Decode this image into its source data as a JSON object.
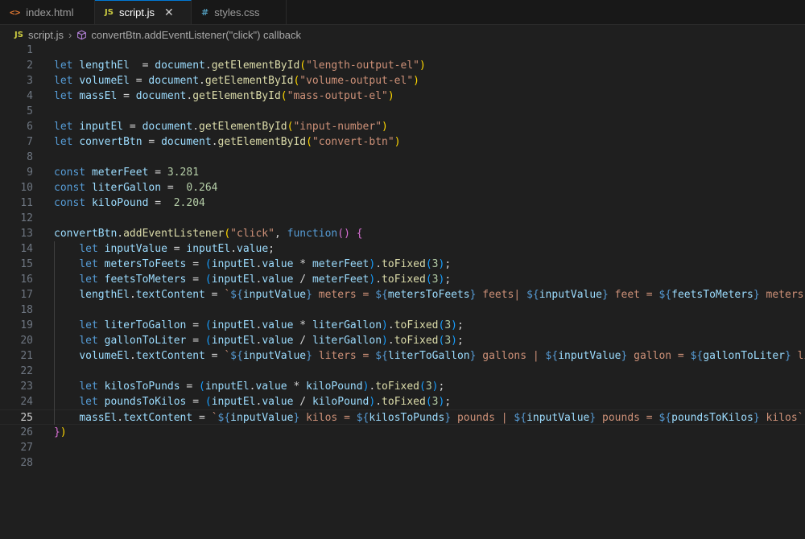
{
  "tabs": [
    {
      "icon": "<>",
      "label": "index.html"
    },
    {
      "icon": "JS",
      "label": "script.js"
    },
    {
      "icon": "#",
      "label": "styles.css"
    }
  ],
  "close_glyph": "✕",
  "breadcrumb": {
    "file_icon": "JS",
    "file": "script.js",
    "separator": "›",
    "symbol": "convertBtn.addEventListener(\"click\") callback"
  },
  "editor": {
    "active_line": 25,
    "lines": [
      {
        "n": "1",
        "t": []
      },
      {
        "n": "2",
        "t": [
          [
            "kw",
            "let "
          ],
          [
            "vr",
            "lengthEl"
          ],
          [
            "",
            "  = "
          ],
          [
            "vr",
            "document"
          ],
          [
            "",
            "."
          ],
          [
            "fn",
            "getElementById"
          ],
          [
            "p1",
            "("
          ],
          [
            "st",
            "\"length-output-el\""
          ],
          [
            "p1",
            ")"
          ]
        ]
      },
      {
        "n": "3",
        "t": [
          [
            "kw",
            "let "
          ],
          [
            "vr",
            "volumeEl"
          ],
          [
            "",
            " = "
          ],
          [
            "vr",
            "document"
          ],
          [
            "",
            "."
          ],
          [
            "fn",
            "getElementById"
          ],
          [
            "p1",
            "("
          ],
          [
            "st",
            "\"volume-output-el\""
          ],
          [
            "p1",
            ")"
          ]
        ]
      },
      {
        "n": "4",
        "t": [
          [
            "kw",
            "let "
          ],
          [
            "vr",
            "massEl"
          ],
          [
            "",
            " = "
          ],
          [
            "vr",
            "document"
          ],
          [
            "",
            "."
          ],
          [
            "fn",
            "getElementById"
          ],
          [
            "p1",
            "("
          ],
          [
            "st",
            "\"mass-output-el\""
          ],
          [
            "p1",
            ")"
          ]
        ]
      },
      {
        "n": "5",
        "t": []
      },
      {
        "n": "6",
        "t": [
          [
            "kw",
            "let "
          ],
          [
            "vr",
            "inputEl"
          ],
          [
            "",
            " = "
          ],
          [
            "vr",
            "document"
          ],
          [
            "",
            "."
          ],
          [
            "fn",
            "getElementById"
          ],
          [
            "p1",
            "("
          ],
          [
            "st",
            "\"input-number\""
          ],
          [
            "p1",
            ")"
          ]
        ]
      },
      {
        "n": "7",
        "t": [
          [
            "kw",
            "let "
          ],
          [
            "vr",
            "convertBtn"
          ],
          [
            "",
            " = "
          ],
          [
            "vr",
            "document"
          ],
          [
            "",
            "."
          ],
          [
            "fn",
            "getElementById"
          ],
          [
            "p1",
            "("
          ],
          [
            "st",
            "\"convert-btn\""
          ],
          [
            "p1",
            ")"
          ]
        ]
      },
      {
        "n": "8",
        "t": []
      },
      {
        "n": "9",
        "t": [
          [
            "kw",
            "const "
          ],
          [
            "vr",
            "meterFeet"
          ],
          [
            "",
            " = "
          ],
          [
            "nu",
            "3.281"
          ]
        ]
      },
      {
        "n": "10",
        "t": [
          [
            "kw",
            "const "
          ],
          [
            "vr",
            "literGallon"
          ],
          [
            "",
            " =  "
          ],
          [
            "nu",
            "0.264"
          ]
        ]
      },
      {
        "n": "11",
        "t": [
          [
            "kw",
            "const "
          ],
          [
            "vr",
            "kiloPound"
          ],
          [
            "",
            " =  "
          ],
          [
            "nu",
            "2.204"
          ]
        ]
      },
      {
        "n": "12",
        "t": []
      },
      {
        "n": "13",
        "t": [
          [
            "vr",
            "convertBtn"
          ],
          [
            "",
            "."
          ],
          [
            "fn",
            "addEventListener"
          ],
          [
            "p1",
            "("
          ],
          [
            "st",
            "\"click\""
          ],
          [
            "",
            ", "
          ],
          [
            "kw",
            "function"
          ],
          [
            "p2",
            "()"
          ],
          [
            "",
            " "
          ],
          [
            "p2",
            "{"
          ]
        ]
      },
      {
        "n": "14",
        "t": [
          [
            "",
            "    "
          ],
          [
            "kw",
            "let "
          ],
          [
            "vr",
            "inputValue"
          ],
          [
            "",
            " = "
          ],
          [
            "vr",
            "inputEl"
          ],
          [
            "",
            "."
          ],
          [
            "vr",
            "value"
          ],
          [
            "",
            ";"
          ]
        ]
      },
      {
        "n": "15",
        "t": [
          [
            "",
            "    "
          ],
          [
            "kw",
            "let "
          ],
          [
            "vr",
            "metersToFeets"
          ],
          [
            "",
            " = "
          ],
          [
            "p3",
            "("
          ],
          [
            "vr",
            "inputEl"
          ],
          [
            "",
            "."
          ],
          [
            "vr",
            "value"
          ],
          [
            "",
            " * "
          ],
          [
            "vr",
            "meterFeet"
          ],
          [
            "p3",
            ")"
          ],
          [
            "",
            "."
          ],
          [
            "fn",
            "toFixed"
          ],
          [
            "p3",
            "("
          ],
          [
            "nu",
            "3"
          ],
          [
            "p3",
            ")"
          ],
          [
            "",
            ";"
          ]
        ]
      },
      {
        "n": "16",
        "t": [
          [
            "",
            "    "
          ],
          [
            "kw",
            "let "
          ],
          [
            "vr",
            "feetsToMeters"
          ],
          [
            "",
            " = "
          ],
          [
            "p3",
            "("
          ],
          [
            "vr",
            "inputEl"
          ],
          [
            "",
            "."
          ],
          [
            "vr",
            "value"
          ],
          [
            "",
            " / "
          ],
          [
            "vr",
            "meterFeet"
          ],
          [
            "p3",
            ")"
          ],
          [
            "",
            "."
          ],
          [
            "fn",
            "toFixed"
          ],
          [
            "p3",
            "("
          ],
          [
            "nu",
            "3"
          ],
          [
            "p3",
            ")"
          ],
          [
            "",
            ";"
          ]
        ]
      },
      {
        "n": "17",
        "t": [
          [
            "",
            "    "
          ],
          [
            "vr",
            "lengthEl"
          ],
          [
            "",
            "."
          ],
          [
            "vr",
            "textContent"
          ],
          [
            "",
            " = "
          ],
          [
            "st",
            "`"
          ],
          [
            "tp",
            "${"
          ],
          [
            "vr",
            "inputValue"
          ],
          [
            "tp",
            "}"
          ],
          [
            "st",
            " meters = "
          ],
          [
            "tp",
            "${"
          ],
          [
            "vr",
            "metersToFeets"
          ],
          [
            "tp",
            "}"
          ],
          [
            "st",
            " feets| "
          ],
          [
            "tp",
            "${"
          ],
          [
            "vr",
            "inputValue"
          ],
          [
            "tp",
            "}"
          ],
          [
            "st",
            " feet = "
          ],
          [
            "tp",
            "${"
          ],
          [
            "vr",
            "feetsToMeters"
          ],
          [
            "tp",
            "}"
          ],
          [
            "st",
            " meters`"
          ],
          [
            "",
            ";"
          ]
        ]
      },
      {
        "n": "18",
        "t": []
      },
      {
        "n": "19",
        "t": [
          [
            "",
            "    "
          ],
          [
            "kw",
            "let "
          ],
          [
            "vr",
            "literToGallon"
          ],
          [
            "",
            " = "
          ],
          [
            "p3",
            "("
          ],
          [
            "vr",
            "inputEl"
          ],
          [
            "",
            "."
          ],
          [
            "vr",
            "value"
          ],
          [
            "",
            " * "
          ],
          [
            "vr",
            "literGallon"
          ],
          [
            "p3",
            ")"
          ],
          [
            "",
            "."
          ],
          [
            "fn",
            "toFixed"
          ],
          [
            "p3",
            "("
          ],
          [
            "nu",
            "3"
          ],
          [
            "p3",
            ")"
          ],
          [
            "",
            ";"
          ]
        ]
      },
      {
        "n": "20",
        "t": [
          [
            "",
            "    "
          ],
          [
            "kw",
            "let "
          ],
          [
            "vr",
            "gallonToLiter"
          ],
          [
            "",
            " = "
          ],
          [
            "p3",
            "("
          ],
          [
            "vr",
            "inputEl"
          ],
          [
            "",
            "."
          ],
          [
            "vr",
            "value"
          ],
          [
            "",
            " / "
          ],
          [
            "vr",
            "literGallon"
          ],
          [
            "p3",
            ")"
          ],
          [
            "",
            "."
          ],
          [
            "fn",
            "toFixed"
          ],
          [
            "p3",
            "("
          ],
          [
            "nu",
            "3"
          ],
          [
            "p3",
            ")"
          ],
          [
            "",
            ";"
          ]
        ]
      },
      {
        "n": "21",
        "t": [
          [
            "",
            "    "
          ],
          [
            "vr",
            "volumeEl"
          ],
          [
            "",
            "."
          ],
          [
            "vr",
            "textContent"
          ],
          [
            "",
            " = "
          ],
          [
            "st",
            "`"
          ],
          [
            "tp",
            "${"
          ],
          [
            "vr",
            "inputValue"
          ],
          [
            "tp",
            "}"
          ],
          [
            "st",
            " liters = "
          ],
          [
            "tp",
            "${"
          ],
          [
            "vr",
            "literToGallon"
          ],
          [
            "tp",
            "}"
          ],
          [
            "st",
            " gallons | "
          ],
          [
            "tp",
            "${"
          ],
          [
            "vr",
            "inputValue"
          ],
          [
            "tp",
            "}"
          ],
          [
            "st",
            " gallon = "
          ],
          [
            "tp",
            "${"
          ],
          [
            "vr",
            "gallonToLiter"
          ],
          [
            "tp",
            "}"
          ],
          [
            "st",
            " lite"
          ]
        ]
      },
      {
        "n": "22",
        "t": []
      },
      {
        "n": "23",
        "t": [
          [
            "",
            "    "
          ],
          [
            "kw",
            "let "
          ],
          [
            "vr",
            "kilosToPunds"
          ],
          [
            "",
            " = "
          ],
          [
            "p3",
            "("
          ],
          [
            "vr",
            "inputEl"
          ],
          [
            "",
            "."
          ],
          [
            "vr",
            "value"
          ],
          [
            "",
            " * "
          ],
          [
            "vr",
            "kiloPound"
          ],
          [
            "p3",
            ")"
          ],
          [
            "",
            "."
          ],
          [
            "fn",
            "toFixed"
          ],
          [
            "p3",
            "("
          ],
          [
            "nu",
            "3"
          ],
          [
            "p3",
            ")"
          ],
          [
            "",
            ";"
          ]
        ]
      },
      {
        "n": "24",
        "t": [
          [
            "",
            "    "
          ],
          [
            "kw",
            "let "
          ],
          [
            "vr",
            "poundsToKilos"
          ],
          [
            "",
            " = "
          ],
          [
            "p3",
            "("
          ],
          [
            "vr",
            "inputEl"
          ],
          [
            "",
            "."
          ],
          [
            "vr",
            "value"
          ],
          [
            "",
            " / "
          ],
          [
            "vr",
            "kiloPound"
          ],
          [
            "p3",
            ")"
          ],
          [
            "",
            "."
          ],
          [
            "fn",
            "toFixed"
          ],
          [
            "p3",
            "("
          ],
          [
            "nu",
            "3"
          ],
          [
            "p3",
            ")"
          ],
          [
            "",
            ";"
          ]
        ]
      },
      {
        "n": "25",
        "t": [
          [
            "",
            "    "
          ],
          [
            "vr",
            "massEl"
          ],
          [
            "",
            "."
          ],
          [
            "vr",
            "textContent"
          ],
          [
            "",
            " = "
          ],
          [
            "st",
            "`"
          ],
          [
            "tp",
            "${"
          ],
          [
            "vr",
            "inputValue"
          ],
          [
            "tp",
            "}"
          ],
          [
            "st",
            " kilos = "
          ],
          [
            "tp",
            "${"
          ],
          [
            "vr",
            "kilosToPunds"
          ],
          [
            "tp",
            "}"
          ],
          [
            "st",
            " pounds | "
          ],
          [
            "tp",
            "${"
          ],
          [
            "vr",
            "inputValue"
          ],
          [
            "tp",
            "}"
          ],
          [
            "st",
            " pounds = "
          ],
          [
            "tp",
            "${"
          ],
          [
            "vr",
            "poundsToKilos"
          ],
          [
            "tp",
            "}"
          ],
          [
            "st",
            " kilos`"
          ],
          [
            "",
            ";"
          ]
        ]
      },
      {
        "n": "26",
        "t": [
          [
            "p2",
            "}"
          ],
          [
            "p1",
            ")"
          ]
        ]
      },
      {
        "n": "27",
        "t": []
      },
      {
        "n": "28",
        "t": []
      }
    ]
  }
}
